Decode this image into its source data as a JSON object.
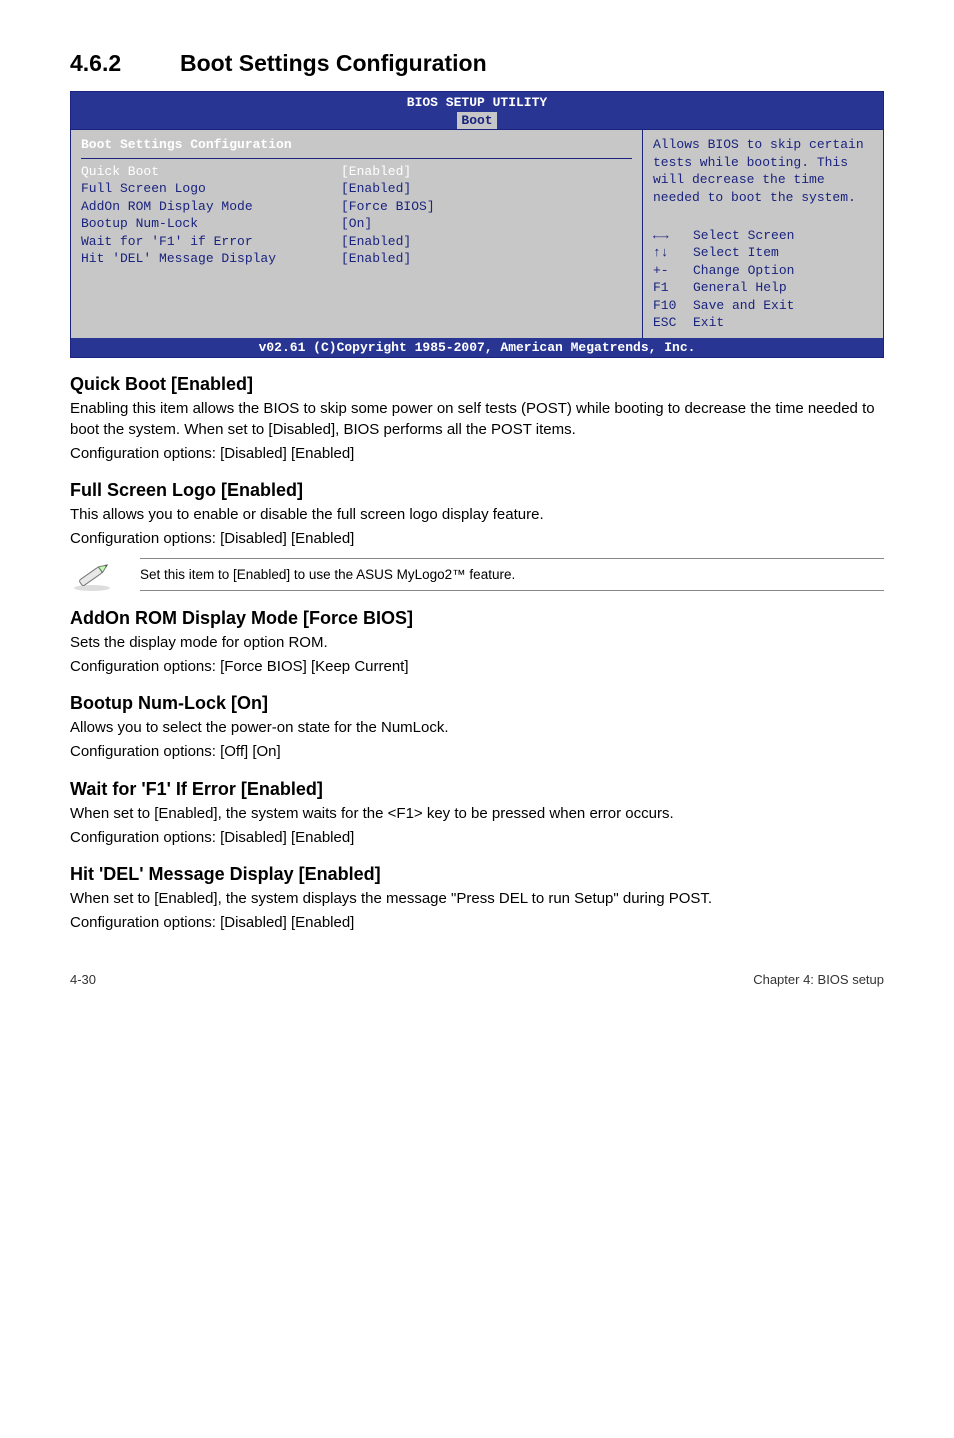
{
  "section": {
    "number": "4.6.2",
    "title": "Boot Settings Configuration"
  },
  "bios": {
    "title_line1": "BIOS SETUP UTILITY",
    "tab": "Boot",
    "left_heading": "Boot Settings Configuration",
    "rows": [
      {
        "k": "Quick Boot",
        "v": "[Enabled]",
        "sel": true
      },
      {
        "k": "Full Screen Logo",
        "v": "[Enabled]"
      },
      {
        "k": "AddOn ROM Display Mode",
        "v": "[Force BIOS]"
      },
      {
        "k": "Bootup Num-Lock",
        "v": "[On]"
      },
      {
        "k": "Wait for 'F1' if Error",
        "v": "[Enabled]"
      },
      {
        "k": "Hit 'DEL' Message Display",
        "v": "[Enabled]"
      }
    ],
    "help_text": "Allows BIOS to skip certain tests while booting. This will decrease the time needed to boot the system.",
    "keys": [
      {
        "k": "←→",
        "v": "Select Screen"
      },
      {
        "k": "↑↓",
        "v": "Select Item"
      },
      {
        "k": "+-",
        "v": "Change Option"
      },
      {
        "k": "F1",
        "v": "General Help"
      },
      {
        "k": "F10",
        "v": "Save and Exit"
      },
      {
        "k": "ESC",
        "v": "Exit"
      }
    ],
    "footer": "v02.61 (C)Copyright 1985-2007, American Megatrends, Inc."
  },
  "options": {
    "quickboot": {
      "h": "Quick Boot [Enabled]",
      "p1": "Enabling this item allows the BIOS to skip some power on self tests (POST) while booting to decrease the time needed to boot the system. When set to [Disabled], BIOS performs all the POST items.",
      "p2": "Configuration options: [Disabled] [Enabled]"
    },
    "fullscreen": {
      "h": "Full Screen Logo [Enabled]",
      "p1": "This allows you to enable or disable the full screen logo display feature.",
      "p2": "Configuration options: [Disabled] [Enabled]"
    },
    "note": "Set this item to [Enabled] to use the ASUS MyLogo2™ feature.",
    "addon": {
      "h": "AddOn ROM Display Mode [Force BIOS]",
      "p1": "Sets the display mode for option ROM.",
      "p2": "Configuration options: [Force BIOS] [Keep Current]"
    },
    "numlock": {
      "h": "Bootup Num-Lock [On]",
      "p1": "Allows you to select the power-on state for the NumLock.",
      "p2": "Configuration options: [Off] [On]"
    },
    "waitf1": {
      "h": "Wait for 'F1' If Error [Enabled]",
      "p1": "When set to [Enabled], the system waits for the <F1> key to be pressed when error occurs.",
      "p2": "Configuration options: [Disabled] [Enabled]"
    },
    "hitdel": {
      "h": "Hit 'DEL' Message Display [Enabled]",
      "p1": "When set to [Enabled], the system displays the message \"Press DEL to run Setup\" during POST.",
      "p2": "Configuration options: [Disabled] [Enabled]"
    }
  },
  "footer": {
    "left": "4-30",
    "right": "Chapter 4: BIOS setup"
  }
}
